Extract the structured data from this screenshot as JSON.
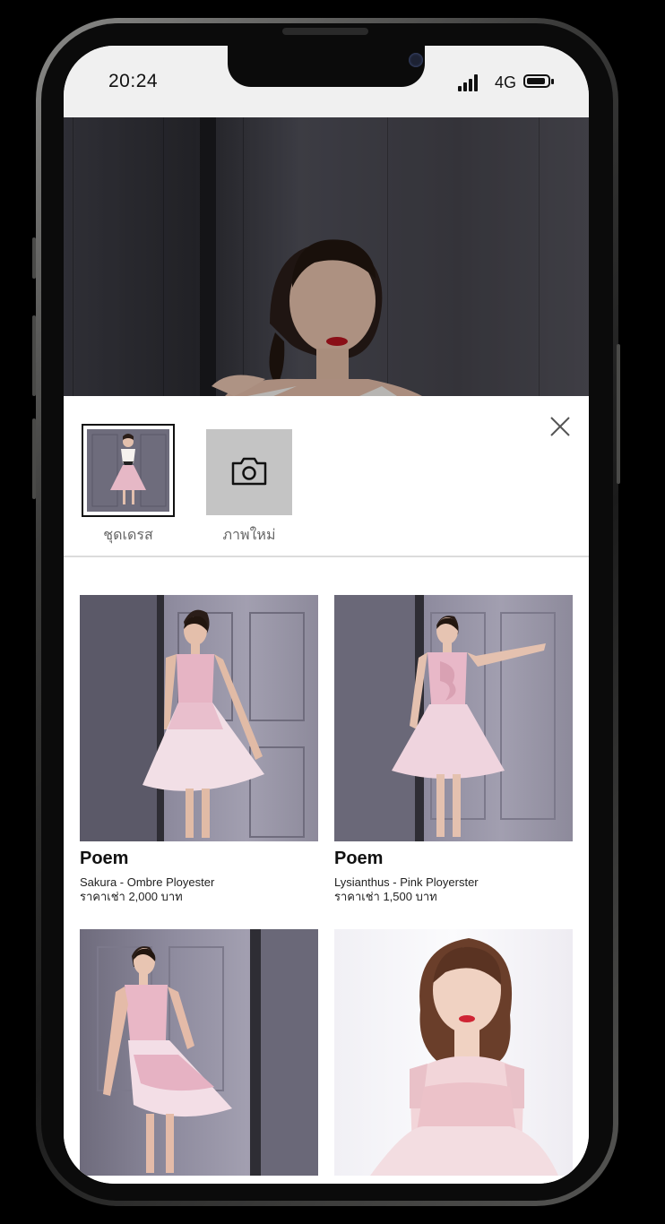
{
  "status_bar": {
    "time": "20:24",
    "network": "4G"
  },
  "colors": {
    "background": "#000000",
    "selected_border": "#111111",
    "camera_tile": "#c4c4c4",
    "divider": "#dcdcdc"
  },
  "search_sheet": {
    "thumbnails": [
      {
        "label": "ชุดเดรส",
        "selected": true
      },
      {
        "label": "ภาพใหม่",
        "selected": false,
        "icon": "camera-icon"
      }
    ],
    "close_icon": "close-icon"
  },
  "products": [
    {
      "brand": "Poem",
      "name": "Sakura - Ombre Ployester",
      "price": "ราคาเช่า 2,000 บาท"
    },
    {
      "brand": "Poem",
      "name": "Lysianthus - Pink Ployerster",
      "price": "ราคาเช่า 1,500 บาท"
    },
    {
      "brand": "",
      "name": "",
      "price": ""
    },
    {
      "brand": "",
      "name": "",
      "price": ""
    }
  ]
}
